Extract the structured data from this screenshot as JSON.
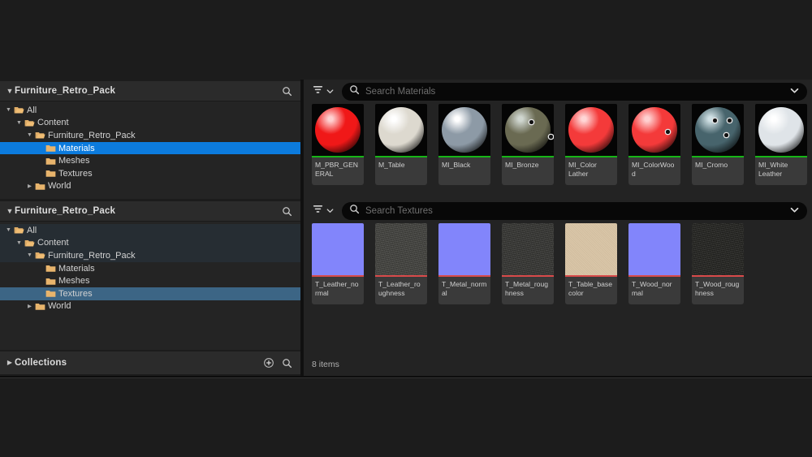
{
  "app": {
    "background": "#1c1c1c"
  },
  "sources_panel": {
    "header": {
      "title": "Furniture_Retro_Pack",
      "caret_icon": "chevron-down-icon",
      "search_icon": "search-icon"
    },
    "tree": [
      {
        "label": "All",
        "depth": 0,
        "expander": "down",
        "folder": "folder-open-icon",
        "state": "normal"
      },
      {
        "label": "Content",
        "depth": 1,
        "expander": "down",
        "folder": "folder-open-icon",
        "state": "normal"
      },
      {
        "label": "Furniture_Retro_Pack",
        "depth": 2,
        "expander": "down",
        "folder": "folder-open-icon",
        "state": "normal"
      },
      {
        "label": "Materials",
        "depth": 3,
        "expander": "none",
        "folder": "folder-icon",
        "state": "selected-active"
      },
      {
        "label": "Meshes",
        "depth": 3,
        "expander": "none",
        "folder": "folder-icon",
        "state": "normal"
      },
      {
        "label": "Textures",
        "depth": 3,
        "expander": "none",
        "folder": "folder-icon",
        "state": "normal"
      },
      {
        "label": "World",
        "depth": 2,
        "expander": "right",
        "folder": "folder-icon",
        "state": "normal"
      }
    ]
  },
  "sources_panel_2": {
    "header": {
      "title": "Furniture_Retro_Pack",
      "caret_icon": "chevron-down-icon",
      "search_icon": "search-icon"
    },
    "tree": [
      {
        "label": "All",
        "depth": 0,
        "expander": "down",
        "folder": "folder-open-icon",
        "state": "band"
      },
      {
        "label": "Content",
        "depth": 1,
        "expander": "down",
        "folder": "folder-open-icon",
        "state": "band"
      },
      {
        "label": "Furniture_Retro_Pack",
        "depth": 2,
        "expander": "down",
        "folder": "folder-open-icon",
        "state": "band"
      },
      {
        "label": "Materials",
        "depth": 3,
        "expander": "none",
        "folder": "folder-icon",
        "state": "normal"
      },
      {
        "label": "Meshes",
        "depth": 3,
        "expander": "none",
        "folder": "folder-icon",
        "state": "normal"
      },
      {
        "label": "Textures",
        "depth": 3,
        "expander": "none",
        "folder": "folder-icon",
        "state": "selected-inactive"
      },
      {
        "label": "World",
        "depth": 2,
        "expander": "right",
        "folder": "folder-icon",
        "state": "normal"
      }
    ]
  },
  "collections_panel": {
    "title": "Collections",
    "caret_icon": "chevron-right-icon",
    "add_icon": "add-circle-icon",
    "search_icon": "search-icon"
  },
  "materials_browser": {
    "filter_icon": "filter-icon",
    "filter_caret_icon": "chevron-down-icon",
    "search_icon": "search-icon",
    "search_placeholder": "Search Materials",
    "search_value": "",
    "options_caret_icon": "chevron-down-icon",
    "accent_color": "#17b517",
    "assets": [
      {
        "name": "M_PBR_GENERAL",
        "type": "material",
        "color": "#f01818",
        "highlight": "#ffd0d0",
        "spots": []
      },
      {
        "name": "M_Table",
        "type": "material",
        "color": "#ddd9cf",
        "highlight": "#ffffff",
        "spots": []
      },
      {
        "name": "MI_Black",
        "type": "material",
        "color": "#8d9aa6",
        "highlight": "#ffffff",
        "spots": []
      },
      {
        "name": "MI_Bronze",
        "type": "material",
        "color": "#6a6a52",
        "highlight": "#cfd6cf",
        "spots": [
          [
            30,
            16
          ],
          [
            54,
            34
          ]
        ]
      },
      {
        "name": "MI_Color Lather",
        "type": "material",
        "color": "#f43a3a",
        "highlight": "#ffd6d6",
        "spots": []
      },
      {
        "name": "MI_ColorWood",
        "type": "material",
        "color": "#f43a3a",
        "highlight": "#ffd0d0",
        "spots": [
          [
            42,
            28
          ]
        ]
      },
      {
        "name": "MI_Cromo",
        "type": "material",
        "color": "#47646c",
        "highlight": "#cfe0e4",
        "spots": [
          [
            22,
            14
          ],
          [
            40,
            14
          ],
          [
            36,
            32
          ]
        ]
      },
      {
        "name": "MI_White Leather",
        "type": "material",
        "color": "#dfe4e8",
        "highlight": "#ffffff",
        "spots": []
      }
    ]
  },
  "textures_browser": {
    "filter_icon": "filter-icon",
    "filter_caret_icon": "chevron-down-icon",
    "search_icon": "search-icon",
    "search_placeholder": "Search Textures",
    "search_value": "",
    "options_caret_icon": "chevron-down-icon",
    "accent_color": "#d84a4a",
    "status_text": "8 items",
    "assets": [
      {
        "name": "T_Leather_normal",
        "type": "texture",
        "swatch": "normal",
        "color": "#8285fb"
      },
      {
        "name": "T_Leather_roughness",
        "type": "texture",
        "swatch": "noise",
        "color": "#43433f"
      },
      {
        "name": "T_Metal_normal",
        "type": "texture",
        "swatch": "normal",
        "color": "#8285fb"
      },
      {
        "name": "T_Metal_roughness",
        "type": "texture",
        "swatch": "noise",
        "color": "#363633"
      },
      {
        "name": "T_Table_basecolor",
        "type": "texture",
        "swatch": "solid",
        "color": "#d9c5a6"
      },
      {
        "name": "T_Wood_normal",
        "type": "texture",
        "swatch": "normal",
        "color": "#8285fb"
      },
      {
        "name": "T_Wood_roughness",
        "type": "texture",
        "swatch": "noise",
        "color": "#232320"
      }
    ]
  }
}
